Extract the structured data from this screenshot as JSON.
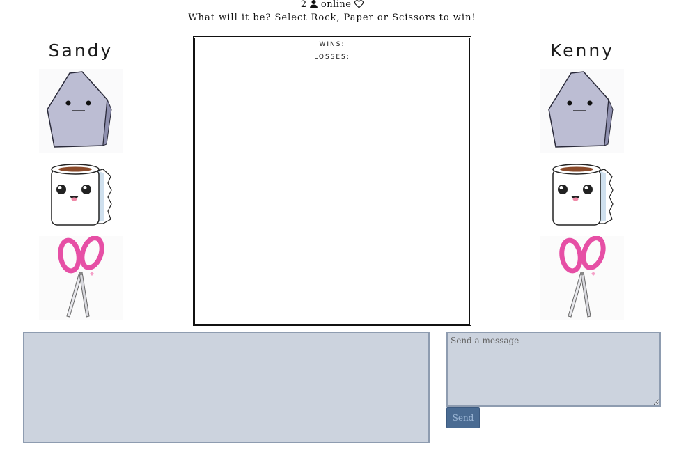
{
  "status": {
    "count": "2",
    "label": "online",
    "person_icon": "person-icon",
    "heart_icon": "heart-outline-icon"
  },
  "prompt": "What will it be? Select Rock, Paper or Scissors to win!",
  "players": {
    "left": {
      "name": "Sandy"
    },
    "right": {
      "name": "Kenny"
    }
  },
  "choices": [
    {
      "name": "Rock",
      "icon": "rock-face-icon"
    },
    {
      "name": "Paper",
      "icon": "toilet-paper-icon"
    },
    {
      "name": "Scissors",
      "icon": "pink-scissors-icon"
    }
  ],
  "scoreboard": {
    "wins_label": "WINS:",
    "losses_label": "LOSSES:"
  },
  "chat": {
    "placeholder": "Send a message",
    "send_label": "Send"
  },
  "colors": {
    "rock": "#bcbdd3",
    "paper_shadow": "#cfe0ee",
    "scissors": "#e64fa5",
    "chat_bg": "#ccd3de",
    "chat_border": "#8e9cb0",
    "send_bg": "#4a6b92"
  }
}
